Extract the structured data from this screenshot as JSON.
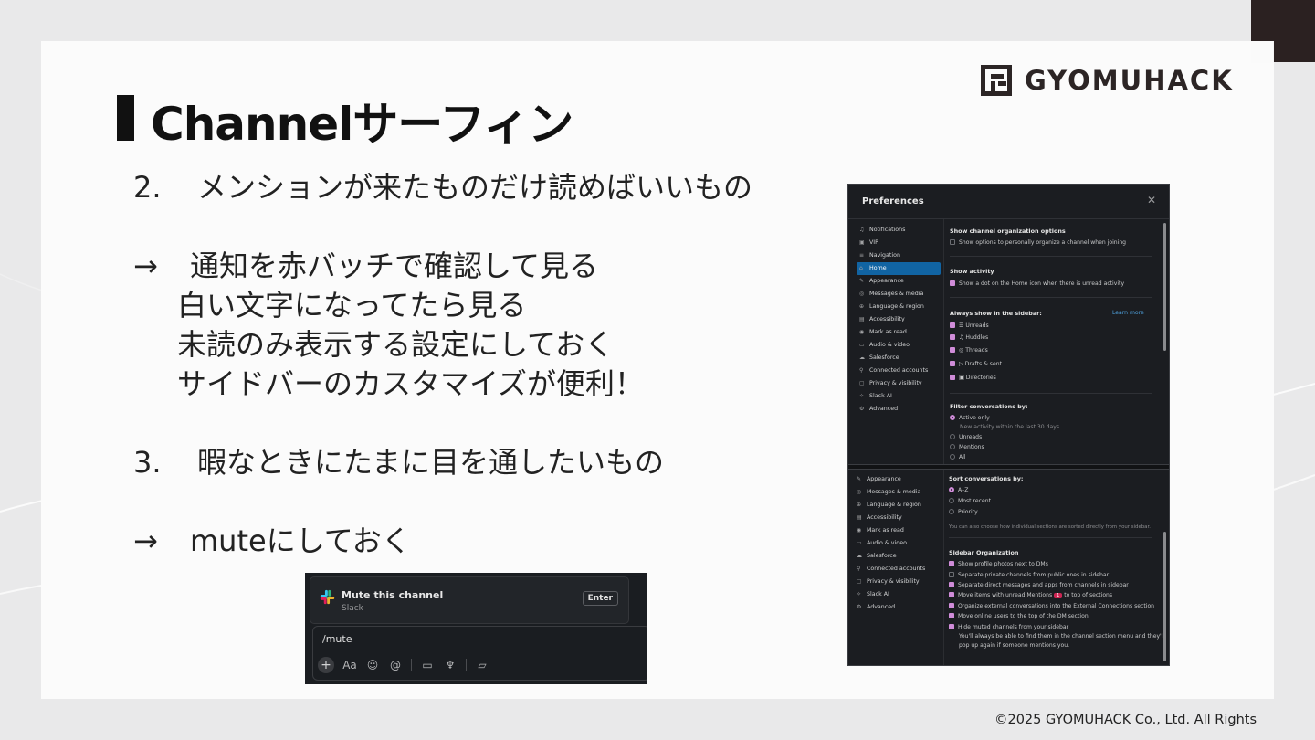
{
  "brand": {
    "name": "GYOMUHACK"
  },
  "slide": {
    "title": "Channelサーフィン",
    "item2_num": "2.",
    "item2_text": "メンションが来たものだけ読めばいいもの",
    "arrow": "→",
    "item2_sub1": "通知を赤バッチで確認して見る",
    "item2_sub2": "白い文字になってたら見る",
    "item2_sub3": "未読のみ表示する設定にしておく",
    "item2_sub4": "サイドバーのカスタマイズが便利！",
    "item3_num": "3.",
    "item3_text": "暇なときにたまに目を通したいもの",
    "item3_sub1": "muteにしておく"
  },
  "preferences": {
    "title": "Preferences",
    "close": "✕",
    "nav_top": [
      {
        "label": "Notifications",
        "icon": "bell-icon",
        "glyph": "♫"
      },
      {
        "label": "VIP",
        "icon": "vip-icon",
        "glyph": "▣"
      },
      {
        "label": "Navigation",
        "icon": "navigation-icon",
        "glyph": "≡"
      },
      {
        "label": "Home",
        "icon": "home-icon",
        "glyph": "⌂",
        "active": true
      },
      {
        "label": "Appearance",
        "icon": "brush-icon",
        "glyph": "✎"
      },
      {
        "label": "Messages & media",
        "icon": "messages-icon",
        "glyph": "◎"
      },
      {
        "label": "Language & region",
        "icon": "globe-icon",
        "glyph": "⊕"
      },
      {
        "label": "Accessibility",
        "icon": "accessibility-icon",
        "glyph": "▤"
      },
      {
        "label": "Mark as read",
        "icon": "check-circle-icon",
        "glyph": "◉"
      },
      {
        "label": "Audio & video",
        "icon": "video-icon",
        "glyph": "▭"
      },
      {
        "label": "Salesforce",
        "icon": "cloud-icon",
        "glyph": "☁"
      },
      {
        "label": "Connected accounts",
        "icon": "key-icon",
        "glyph": "⚲"
      },
      {
        "label": "Privacy & visibility",
        "icon": "lock-icon",
        "glyph": "▢"
      },
      {
        "label": "Slack AI",
        "icon": "sparkle-icon",
        "glyph": "✧"
      },
      {
        "label": "Advanced",
        "icon": "gear-icon",
        "glyph": "⚙"
      }
    ],
    "nav_bottom": [
      {
        "label": "Appearance",
        "icon": "brush-icon",
        "glyph": "✎"
      },
      {
        "label": "Messages & media",
        "icon": "messages-icon",
        "glyph": "◎"
      },
      {
        "label": "Language & region",
        "icon": "globe-icon",
        "glyph": "⊕"
      },
      {
        "label": "Accessibility",
        "icon": "accessibility-icon",
        "glyph": "▤"
      },
      {
        "label": "Mark as read",
        "icon": "check-circle-icon",
        "glyph": "◉"
      },
      {
        "label": "Audio & video",
        "icon": "video-icon",
        "glyph": "▭"
      },
      {
        "label": "Salesforce",
        "icon": "cloud-icon",
        "glyph": "☁"
      },
      {
        "label": "Connected accounts",
        "icon": "key-icon",
        "glyph": "⚲"
      },
      {
        "label": "Privacy & visibility",
        "icon": "lock-icon",
        "glyph": "▢"
      },
      {
        "label": "Slack AI",
        "icon": "sparkle-icon",
        "glyph": "✧"
      },
      {
        "label": "Advanced",
        "icon": "gear-icon",
        "glyph": "⚙"
      }
    ],
    "show_channel_org": {
      "heading": "Show channel organization options",
      "option": "Show options to personally organize a channel when joining",
      "checked": false
    },
    "show_activity": {
      "heading": "Show activity",
      "option": "Show a dot on the Home icon when there is unread activity",
      "checked": true
    },
    "always_show": {
      "heading": "Always show in the sidebar:",
      "learn_more": "Learn more",
      "items": [
        "Unreads",
        "Huddles",
        "Threads",
        "Drafts & sent",
        "Directories"
      ]
    },
    "filter": {
      "heading": "Filter conversations by:",
      "options": [
        "Active only",
        "Unreads",
        "Mentions",
        "All"
      ],
      "active_hint": "New activity within the last 30 days",
      "selected": "Active only"
    },
    "sort": {
      "heading": "Sort conversations by:",
      "options": [
        "A–Z",
        "Most recent",
        "Priority"
      ],
      "selected": "A–Z",
      "note": "You can also choose how individual sections are sorted directly from your sidebar."
    },
    "sidebar_org": {
      "heading": "Sidebar Organization",
      "items": [
        {
          "label": "Show profile photos next to DMs",
          "checked": true
        },
        {
          "label": "Separate private channels from public ones in sidebar",
          "checked": false
        },
        {
          "label": "Separate direct messages and apps from channels in sidebar",
          "checked": true
        },
        {
          "label_before": "Move items with unread Mentions",
          "badge": "1",
          "label_after": "to top of sections",
          "checked": true
        },
        {
          "label": "Organize external conversations into the External Connections section",
          "checked": true
        },
        {
          "label": "Move online users to the top of the DM section",
          "checked": true
        },
        {
          "label": "Hide muted channels from your sidebar",
          "checked": true
        }
      ],
      "hint1": "You'll always be able to find them in the channel section menu and they'll",
      "hint2": "pop up again if someone mentions you."
    }
  },
  "mute_ui": {
    "command_title": "Mute this channel",
    "app": "Slack",
    "enter_label": "Enter",
    "input_value": "/mute",
    "tools": [
      {
        "name": "plus-icon",
        "glyph": "+"
      },
      {
        "name": "format-icon",
        "glyph": "Aa"
      },
      {
        "name": "emoji-icon",
        "glyph": "☺"
      },
      {
        "name": "mention-icon",
        "glyph": "@"
      },
      {
        "name": "video-icon",
        "glyph": "▭"
      },
      {
        "name": "mic-icon",
        "glyph": "♆"
      },
      {
        "name": "shortcut-icon",
        "glyph": "▱"
      }
    ]
  },
  "footer": {
    "copyright": "©2025 GYOMUHACK Co., Ltd. All Rights"
  },
  "colors": {
    "accent": "#1164a3",
    "checkbox": "#d08cd9",
    "badge": "#cd2553"
  }
}
